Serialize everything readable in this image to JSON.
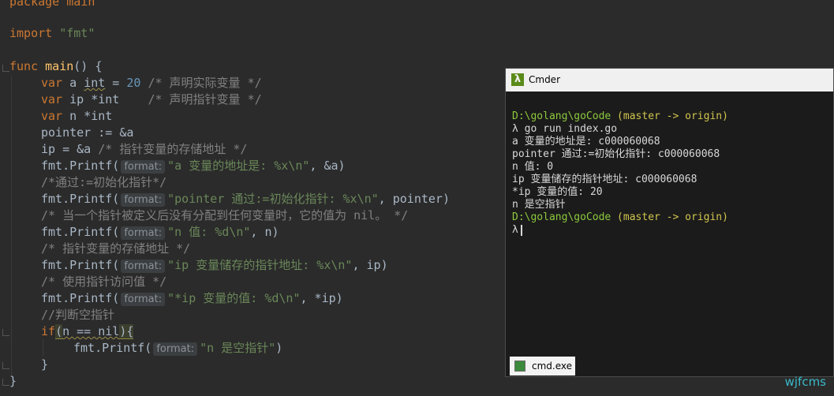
{
  "code": {
    "l0": "package main",
    "l1_kw": "import",
    "l1_str": "\"fmt\"",
    "l2_kw": "func",
    "l2_fn": "main",
    "l2_rest": "() {",
    "l3_kw": "var",
    "l3_a": " a ",
    "l3_type": "int",
    "l3_eq": " = ",
    "l3_num": "20",
    "l3_cmt": " /* 声明实际变量 */",
    "l4_kw": "var",
    "l4_a": " ip *int    ",
    "l4_cmt": "/* 声明指针变量 */",
    "l5_kw": "var",
    "l5_a": " n *int",
    "l6": "pointer := &a",
    "l7_a": "ip = &a ",
    "l7_cmt": "/* 指针变量的存储地址 */",
    "printf": "fmt.Printf(",
    "hint": "format:",
    "l8_str": "\"a 变量的地址是: %x\\n\"",
    "l8_rest": ", &a)",
    "l9_cmt": "/*通过:=初始化指针*/",
    "l10_str": "\"pointer 通过:=初始化指针: %x\\n\"",
    "l10_rest": ", pointer)",
    "l11_cmt": "/* 当一个指针被定义后没有分配到任何变量时，它的值为 nil。 */",
    "l12_str": "\"n 值: %d\\n\"",
    "l12_rest": ", n)",
    "l13_cmt": "/* 指针变量的存储地址 */",
    "l14_str": "\"ip 变量储存的指针地址: %x\\n\"",
    "l14_rest": ", ip)",
    "l15_cmt": "/* 使用指针访问值 */",
    "l16_str": "\"*ip 变量的值: %d\\n\"",
    "l16_rest": ", *ip)",
    "l17_cmt": "//判断空指针",
    "l18_kw": "if",
    "l18_open": "(",
    "l18_cond": "n == nil",
    "l18_close": "){",
    "l19_str": "\"n 是空指针\"",
    "l19_rest": ")",
    "l20": "}",
    "l21": "}"
  },
  "terminal": {
    "title": "Cmder",
    "icon_glyph": "λ",
    "path1": "D:\\golang\\goCode",
    "branch1": " (master -> origin)",
    "prompt": "λ",
    "command": " go run index.go",
    "out1": "a 变量的地址是: c000060068",
    "out2": "pointer 通过:=初始化指针: c000060068",
    "out3": "n 值: 0",
    "out4": "ip 变量储存的指针地址: c000060068",
    "out5": "*ip 变量的值: 20",
    "out6": "n 是空指针",
    "path2": "D:\\golang\\goCode",
    "branch2": " (master -> origin)",
    "tab_label": "cmd.exe"
  },
  "watermark": "wjfcms"
}
